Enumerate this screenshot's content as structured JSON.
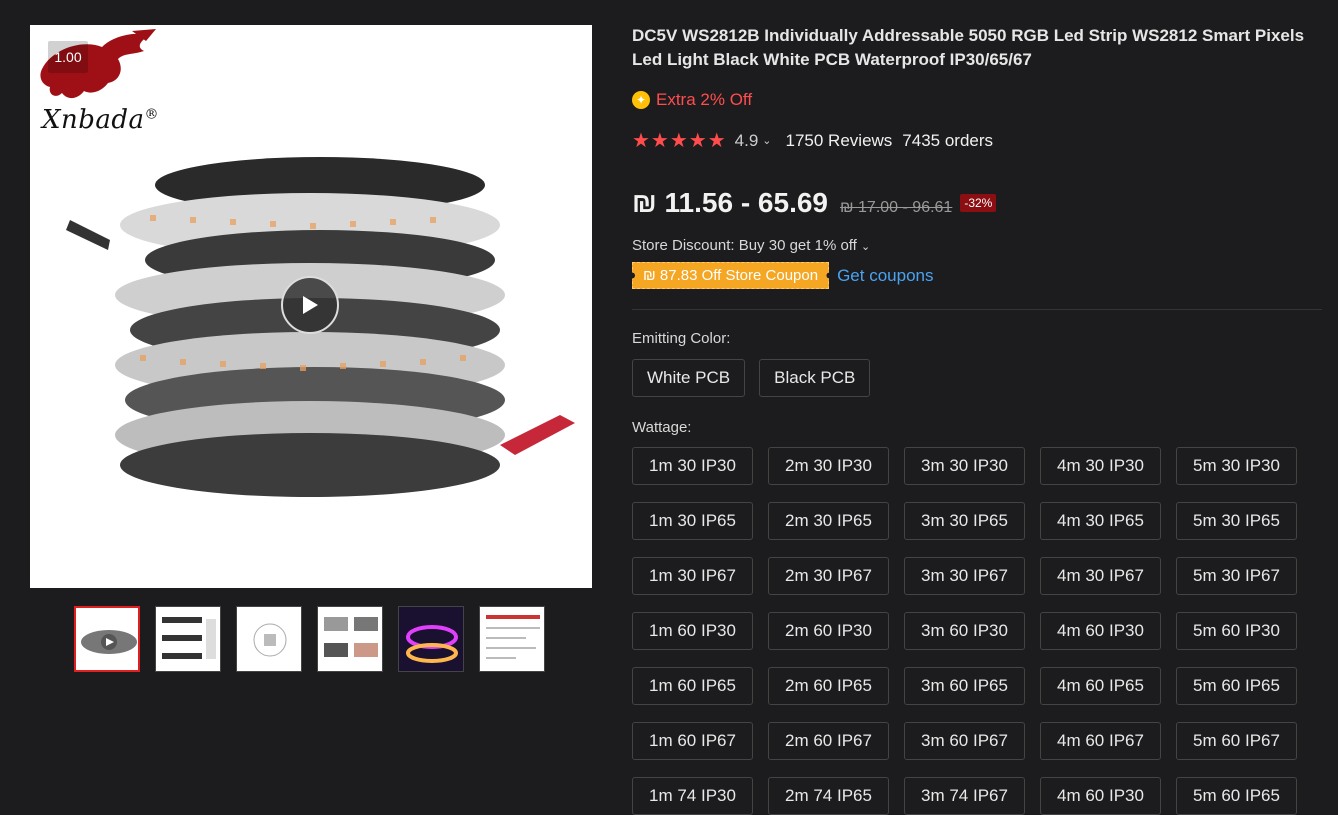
{
  "gallery": {
    "zoom_label": "1.00",
    "brand_text": "Xnbada",
    "brand_mark": "®",
    "thumbnail_count": 6
  },
  "product": {
    "title": "DC5V WS2812B Individually Addressable 5050 RGB Led Strip WS2812 Smart Pixels Led Light Black White PCB Waterproof IP30/65/67",
    "extra_off": "Extra 2% Off",
    "stars": "★★★★★",
    "rating": "4.9",
    "reviews": "1750 Reviews",
    "orders": "7435 orders",
    "price": "₪ 11.56 - 65.69",
    "old_price": "₪ 17.00 - 96.61",
    "discount": "-32%",
    "store_discount": "Store Discount: Buy 30 get 1% off",
    "coupon": "₪ 87.83 Off Store Coupon",
    "get_coupons": "Get coupons"
  },
  "emitting_color": {
    "label": "Emitting Color:",
    "options": [
      "White PCB",
      "Black PCB"
    ]
  },
  "wattage": {
    "label": "Wattage:",
    "options": [
      "1m 30 IP30",
      "2m 30 IP30",
      "3m 30 IP30",
      "4m 30 IP30",
      "5m 30 IP30",
      "1m 30 IP65",
      "2m 30 IP65",
      "3m 30 IP65",
      "4m 30 IP65",
      "5m 30 IP65",
      "1m 30 IP67",
      "2m 30 IP67",
      "3m 30 IP67",
      "4m 30 IP67",
      "5m 30 IP67",
      "1m 60 IP30",
      "2m 60 IP30",
      "3m 60 IP30",
      "4m 60 IP30",
      "5m 60 IP30",
      "1m 60 IP65",
      "2m 60 IP65",
      "3m 60 IP65",
      "4m 60 IP65",
      "5m 60 IP65",
      "1m 60 IP67",
      "2m 60 IP67",
      "3m 60 IP67",
      "4m 60 IP67",
      "5m 60 IP67",
      "1m 74 IP30",
      "2m 74 IP65",
      "3m 74 IP67",
      "4m 60 IP30",
      "5m 60 IP65"
    ]
  },
  "colors": {
    "accent_red": "#ff4d4f",
    "coupon_orange": "#f5a623",
    "link_blue": "#4aa3f0"
  }
}
